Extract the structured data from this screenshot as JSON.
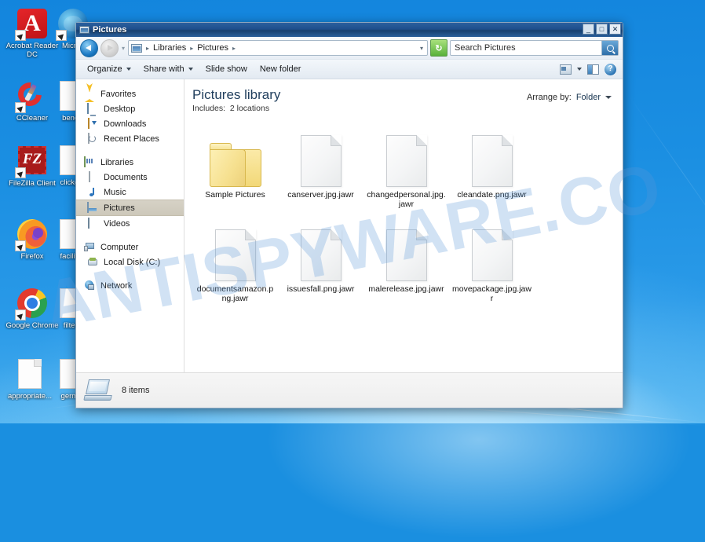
{
  "desktop": {
    "icons": [
      {
        "label": "Acrobat Reader DC",
        "icon": "acrobat-reader-icon"
      },
      {
        "label": "CCleaner",
        "icon": "ccleaner-icon"
      },
      {
        "label": "FileZilla Client",
        "icon": "filezilla-icon"
      },
      {
        "label": "Firefox",
        "icon": "firefox-icon"
      },
      {
        "label": "Google Chrome",
        "icon": "chrome-icon"
      },
      {
        "label": "appropriate...",
        "icon": "encrypted-file-icon"
      },
      {
        "label": "Micros",
        "icon": "microsoft-edge-icon"
      },
      {
        "label": "benef",
        "icon": "encrypted-file-icon"
      },
      {
        "label": "clickgo",
        "icon": "encrypted-file-icon"
      },
      {
        "label": "facilitie",
        "icon": "encrypted-file-icon"
      },
      {
        "label": "filtert",
        "icon": "encrypted-file-icon"
      },
      {
        "label": "germa",
        "icon": "encrypted-file-icon"
      }
    ],
    "wallpaper_color": "#1b8fe2"
  },
  "watermark": {
    "text": "ANTISPYWARE.CO",
    "color": "#5a96d7"
  },
  "window": {
    "title": "Pictures",
    "title_icon": "pictures-library-icon",
    "buttons": {
      "minimize": "_",
      "maximize": "□",
      "close": "✕"
    }
  },
  "navbar": {
    "back_icon": "back-arrow-icon",
    "forward_icon": "forward-arrow-icon",
    "history_caret": "▾",
    "address_icon": "library-icon",
    "breadcrumbs": [
      "Libraries",
      "Pictures"
    ],
    "breadcrumb_sep": "▸",
    "address_caret": "▾",
    "refresh_icon": "refresh-icon",
    "refresh_glyph": "↻",
    "search": {
      "value": "",
      "placeholder": "Search Pictures",
      "icon": "search-icon"
    }
  },
  "command_bar": {
    "items": [
      {
        "label": "Organize",
        "has_caret": true
      },
      {
        "label": "Share with",
        "has_caret": true
      },
      {
        "label": "Slide show",
        "has_caret": false
      },
      {
        "label": "New folder",
        "has_caret": false
      }
    ],
    "right_icons": [
      {
        "name": "change-view-icon"
      },
      {
        "name": "view-caret-icon"
      },
      {
        "name": "preview-pane-icon"
      },
      {
        "name": "help-icon",
        "glyph": "?"
      }
    ]
  },
  "nav_pane": {
    "groups": [
      {
        "header": {
          "label": "Favorites",
          "icon": "favorites-star-icon"
        },
        "items": [
          {
            "label": "Desktop",
            "icon": "desktop-icon",
            "selected": false
          },
          {
            "label": "Downloads",
            "icon": "downloads-icon",
            "selected": false
          },
          {
            "label": "Recent Places",
            "icon": "recent-places-icon",
            "selected": false
          }
        ]
      },
      {
        "header": {
          "label": "Libraries",
          "icon": "libraries-icon"
        },
        "items": [
          {
            "label": "Documents",
            "icon": "documents-icon",
            "selected": false
          },
          {
            "label": "Music",
            "icon": "music-icon",
            "selected": false
          },
          {
            "label": "Pictures",
            "icon": "pictures-icon",
            "selected": true
          },
          {
            "label": "Videos",
            "icon": "videos-icon",
            "selected": false
          }
        ]
      },
      {
        "header": {
          "label": "Computer",
          "icon": "computer-icon"
        },
        "items": [
          {
            "label": "Local Disk (C:)",
            "icon": "local-disk-icon",
            "selected": false
          }
        ]
      },
      {
        "header": {
          "label": "Network",
          "icon": "network-icon"
        },
        "items": []
      }
    ]
  },
  "content": {
    "library_title": "Pictures library",
    "includes_label": "Includes:",
    "includes_value": "2 locations",
    "arrange": {
      "label": "Arrange by:",
      "value": "Folder",
      "caret_icon": "chevron-down-icon"
    },
    "items": [
      {
        "name": "Sample Pictures",
        "type": "folder",
        "icon": "picture-folder-icon"
      },
      {
        "name": "canserver.jpg.jawr",
        "type": "file",
        "icon": "encrypted-file-icon"
      },
      {
        "name": "changedpersonal.jpg.jawr",
        "type": "file",
        "icon": "encrypted-file-icon"
      },
      {
        "name": "cleandate.png.jawr",
        "type": "file",
        "icon": "encrypted-file-icon"
      },
      {
        "name": "documentsamazon.png.jawr",
        "type": "file",
        "icon": "encrypted-file-icon"
      },
      {
        "name": "issuesfall.png.jawr",
        "type": "file",
        "icon": "encrypted-file-icon"
      },
      {
        "name": "malerelease.jpg.jawr",
        "type": "file",
        "icon": "encrypted-file-icon"
      },
      {
        "name": "movepackage.jpg.jawr",
        "type": "file",
        "icon": "encrypted-file-icon"
      }
    ]
  },
  "status_bar": {
    "icon": "computer-items-icon",
    "text": "8 items"
  }
}
